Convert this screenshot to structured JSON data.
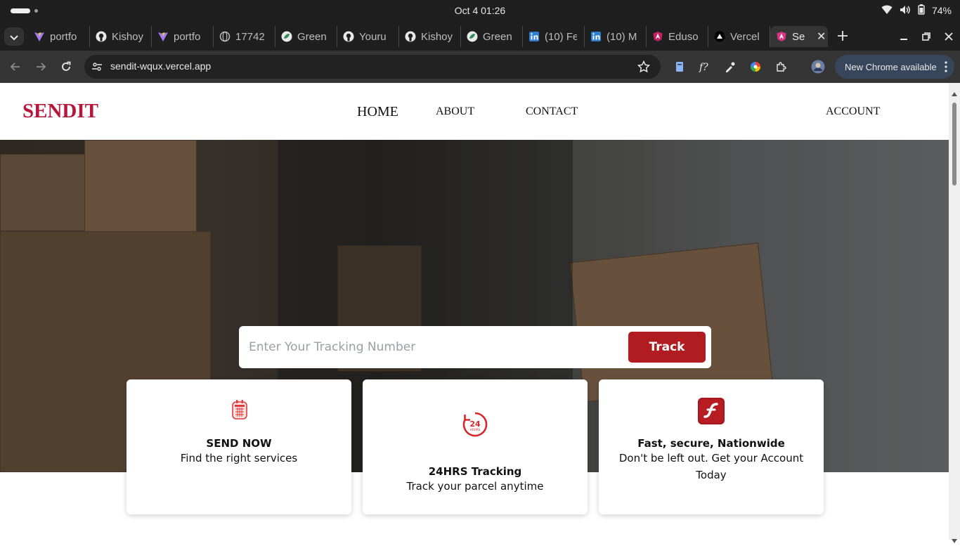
{
  "system": {
    "clock": "Oct 4  01:26",
    "battery": "74%"
  },
  "tabs": [
    {
      "title": "portfo",
      "icon": "vite-icon"
    },
    {
      "title": "Kishoy",
      "icon": "github-icon"
    },
    {
      "title": "portfo",
      "icon": "vite-icon"
    },
    {
      "title": "17742",
      "icon": "globe-icon"
    },
    {
      "title": "Green",
      "icon": "green-leaf-icon"
    },
    {
      "title": "Youru",
      "icon": "github-icon"
    },
    {
      "title": "Kishoy",
      "icon": "github-icon"
    },
    {
      "title": "Green",
      "icon": "green-leaf-icon"
    },
    {
      "title": "(10) Fe",
      "icon": "linkedin-icon"
    },
    {
      "title": "(10) M",
      "icon": "linkedin-icon"
    },
    {
      "title": "Eduso",
      "icon": "angular-icon"
    },
    {
      "title": "Vercel",
      "icon": "vercel-icon"
    },
    {
      "title": "Se",
      "icon": "sendit-icon",
      "active": true
    }
  ],
  "browser": {
    "url": "sendit-wqux.vercel.app",
    "update_label": "New Chrome available"
  },
  "site": {
    "logo": "SENDIT",
    "nav": {
      "home": "HOME",
      "about": "ABOUT",
      "contact": "CONTACT",
      "account": "ACCOUNT"
    },
    "tracking": {
      "placeholder": "Enter Your Tracking Number",
      "button": "Track"
    },
    "cards": [
      {
        "title": "SEND NOW",
        "desc": "Find the right services",
        "icon": "calendar-icon"
      },
      {
        "title": "24HRS Tracking",
        "desc": "Track your parcel anytime",
        "icon": "24-hours-icon"
      },
      {
        "title": "Fast, secure, Nationwide",
        "desc": "Don't be left out. Get your Account Today",
        "icon": "flash-icon"
      }
    ]
  },
  "colors": {
    "brand": "#b8153b",
    "button": "#b01c20",
    "chrome_dark": "#1f1f1f"
  }
}
